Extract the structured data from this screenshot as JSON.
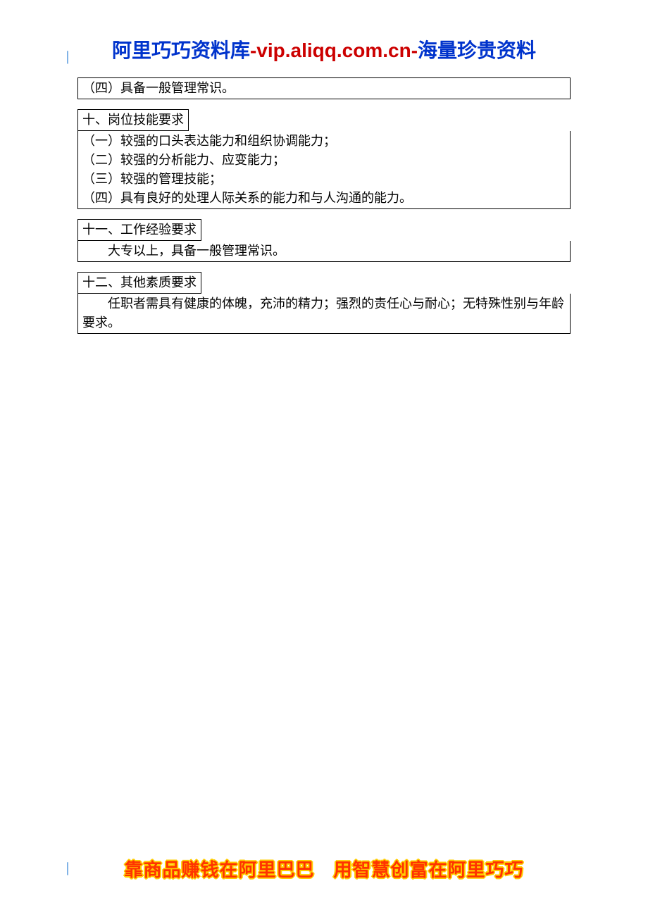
{
  "header": {
    "part1": "阿里巧巧资料库",
    "dash1": "-",
    "part2": "vip.aliqq.com.cn",
    "dash2": "-",
    "part3": "海量珍贵资料"
  },
  "topBox": {
    "line1": "（四）具备一般管理常识。"
  },
  "section10": {
    "title": "十、岗位技能要求",
    "lines": [
      "（一）较强的口头表达能力和组织协调能力；",
      "（二）较强的分析能力、应变能力；",
      "（三）较强的管理技能；",
      "（四）具有良好的处理人际关系的能力和与人沟通的能力。"
    ]
  },
  "section11": {
    "title": "十一、工作经验要求",
    "body": "大专以上，具备一般管理常识。"
  },
  "section12": {
    "title": "十二、其他素质要求",
    "body": "任职者需具有健康的体魄，充沛的精力；强烈的责任心与耐心；无特殊性别与年龄要求。"
  },
  "footer": {
    "text": "靠商品赚钱在阿里巴巴　用智慧创富在阿里巧巧"
  }
}
